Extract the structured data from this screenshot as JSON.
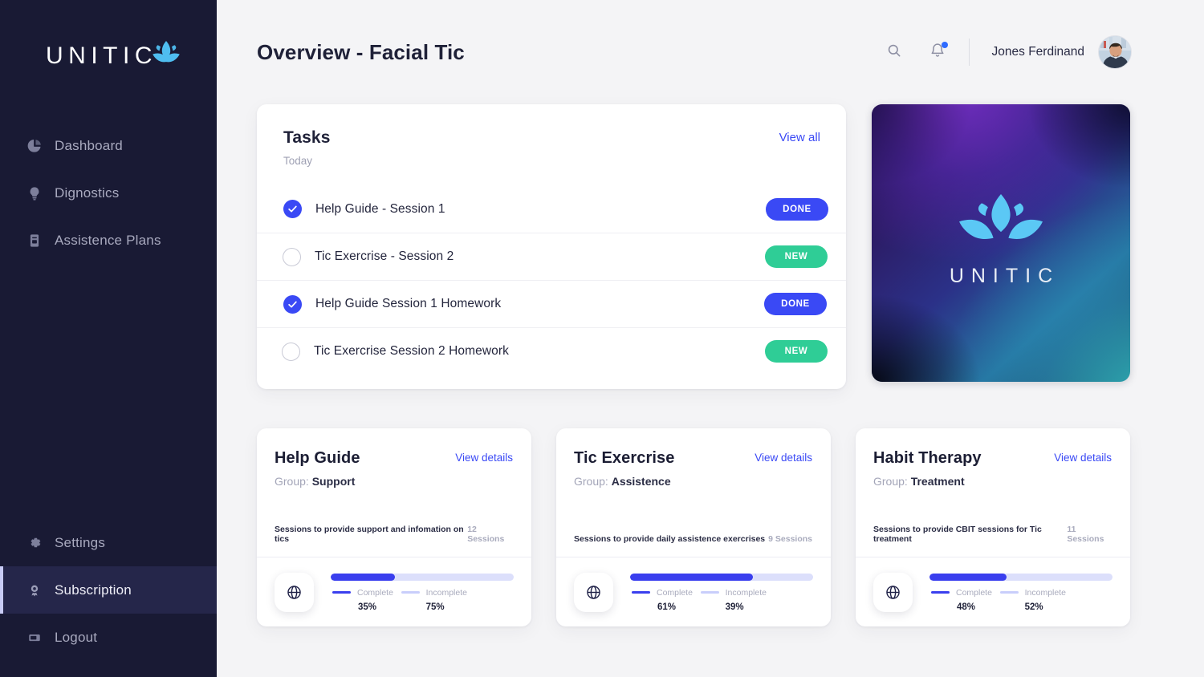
{
  "sidebar": {
    "logo": {
      "text": "UNITIC",
      "mark": "lotus-icon"
    },
    "top_items": [
      {
        "label": "Dashboard",
        "icon": "pie-chart-icon",
        "active": false
      },
      {
        "label": "Dignostics",
        "icon": "lightbulb-icon",
        "active": false
      },
      {
        "label": "Assistence Plans",
        "icon": "book-icon",
        "active": false
      }
    ],
    "bottom_items": [
      {
        "label": "Settings",
        "icon": "gear-icon",
        "active": false
      },
      {
        "label": "Subscription",
        "icon": "award-icon",
        "active": true
      },
      {
        "label": "Logout",
        "icon": "logout-icon",
        "active": false
      }
    ]
  },
  "header": {
    "title": "Overview - Facial Tic",
    "search_icon": "search-icon",
    "bell_icon": "bell-icon",
    "has_notification": true,
    "user_name": "Jones Ferdinand",
    "avatar": "user-avatar"
  },
  "tasks": {
    "title": "Tasks",
    "subtitle": "Today",
    "view_all_label": "View all",
    "items": [
      {
        "name": "Help Guide - Session 1",
        "checked": true,
        "badge": "DONE",
        "badge_type": "done"
      },
      {
        "name": "Tic Exercrise - Session 2",
        "checked": false,
        "badge": "NEW",
        "badge_type": "new"
      },
      {
        "name": "Help Guide Session 1 Homework",
        "checked": true,
        "badge": "DONE",
        "badge_type": "done"
      },
      {
        "name": "Tic Exercrise Session 2 Homework",
        "checked": false,
        "badge": "NEW",
        "badge_type": "new"
      }
    ]
  },
  "promo": {
    "brand": "UNITIC",
    "logo_icon": "lotus-icon"
  },
  "plans": [
    {
      "title": "Help Guide",
      "details_label": "View details",
      "group_label": "Group:",
      "group_value": "Support",
      "description": "Sessions to provide support and infomation on tics",
      "sessions": "12 Sessions",
      "icon": "globe-icon",
      "complete_label": "Complete",
      "incomplete_label": "Incomplete",
      "complete_value": "35%",
      "incomplete_value": "75%",
      "progress_percent": 35
    },
    {
      "title": "Tic Exercrise",
      "details_label": "View details",
      "group_label": "Group:",
      "group_value": "Assistence",
      "description": "Sessions to provide daily assistence exercrises",
      "sessions": "9 Sessions",
      "icon": "globe-icon",
      "complete_label": "Complete",
      "incomplete_label": "Incomplete",
      "complete_value": "61%",
      "incomplete_value": "39%",
      "progress_percent": 61
    },
    {
      "title": "Habit Therapy",
      "details_label": "View details",
      "group_label": "Group:",
      "group_value": "Treatment",
      "description": "Sessions to provide CBIT sessions for Tic treatment",
      "sessions": "11 Sessions",
      "icon": "globe-icon",
      "complete_label": "Complete",
      "incomplete_label": "Incomplete",
      "complete_value": "48%",
      "incomplete_value": "52%",
      "progress_percent": 48
    }
  ],
  "colors": {
    "sidebar_bg": "#191A34",
    "accent_blue": "#3A49F5",
    "accent_green": "#2FCD96",
    "page_bg": "#F4F4F6",
    "progress_track": "#DCDFFB"
  }
}
